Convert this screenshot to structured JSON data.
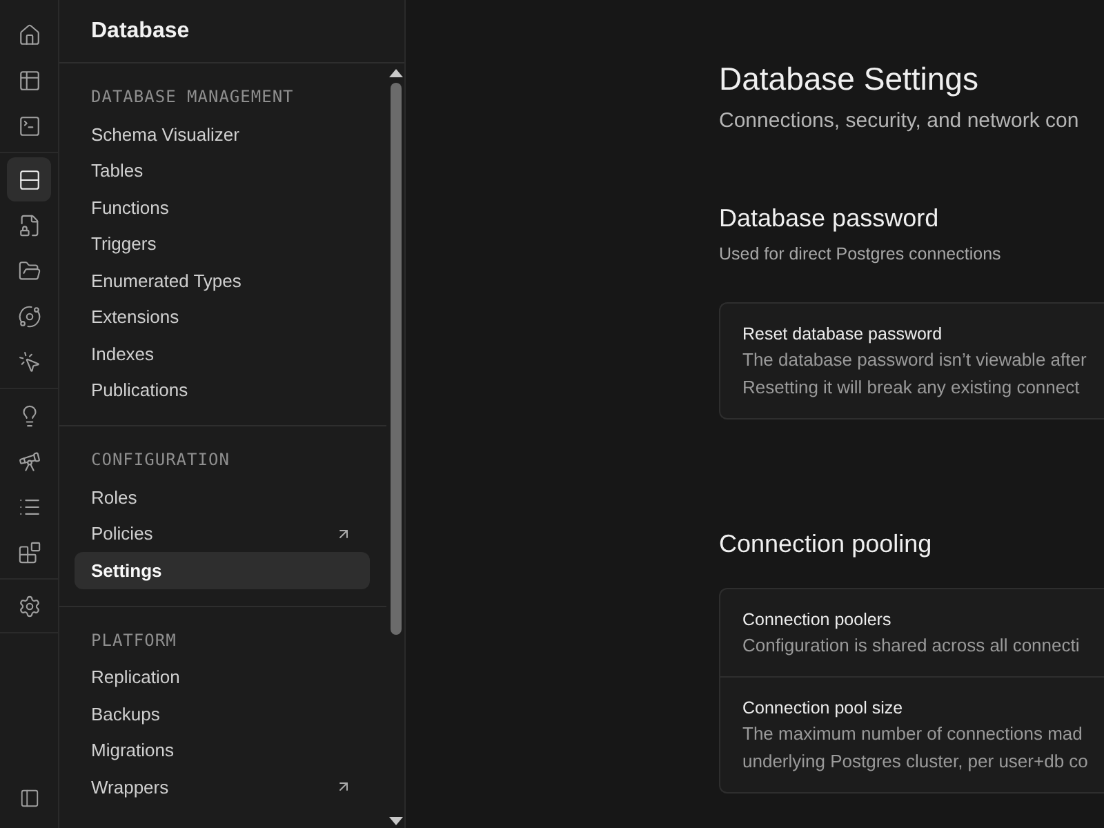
{
  "rail": {
    "groups": [
      [
        {
          "selected": false
        },
        {
          "selected": false
        },
        {
          "selected": false
        }
      ],
      [
        {
          "selected": true
        },
        {
          "selected": false
        },
        {
          "selected": false
        },
        {
          "selected": false
        },
        {
          "selected": false
        }
      ],
      [
        {
          "selected": false
        },
        {
          "selected": false
        },
        {
          "selected": false
        },
        {
          "selected": false
        }
      ],
      [
        {
          "selected": false
        }
      ]
    ]
  },
  "sidebar": {
    "title": "Database",
    "sections": [
      {
        "title": "DATABASE MANAGEMENT",
        "items": [
          {
            "label": "Schema Visualizer",
            "selected": false,
            "external": false
          },
          {
            "label": "Tables",
            "selected": false,
            "external": false
          },
          {
            "label": "Functions",
            "selected": false,
            "external": false
          },
          {
            "label": "Triggers",
            "selected": false,
            "external": false
          },
          {
            "label": "Enumerated Types",
            "selected": false,
            "external": false
          },
          {
            "label": "Extensions",
            "selected": false,
            "external": false
          },
          {
            "label": "Indexes",
            "selected": false,
            "external": false
          },
          {
            "label": "Publications",
            "selected": false,
            "external": false
          }
        ]
      },
      {
        "title": "CONFIGURATION",
        "items": [
          {
            "label": "Roles",
            "selected": false,
            "external": false
          },
          {
            "label": "Policies",
            "selected": false,
            "external": true
          },
          {
            "label": "Settings",
            "selected": true,
            "external": false
          }
        ]
      },
      {
        "title": "PLATFORM",
        "items": [
          {
            "label": "Replication",
            "selected": false,
            "external": false
          },
          {
            "label": "Backups",
            "selected": false,
            "external": false
          },
          {
            "label": "Migrations",
            "selected": false,
            "external": false
          },
          {
            "label": "Wrappers",
            "selected": false,
            "external": true
          }
        ]
      }
    ]
  },
  "page": {
    "title": "Database Settings",
    "subtitle": "Connections, security, and network con"
  },
  "sections": [
    {
      "title": "Database password",
      "description": "Used for direct Postgres connections",
      "rows": [
        {
          "title": "Reset database password",
          "lines": [
            "The database password isn’t viewable after",
            "Resetting it will break any existing connect"
          ]
        }
      ]
    },
    {
      "title": "Connection pooling",
      "rows": [
        {
          "title": "Connection poolers",
          "lines": [
            "Configuration is shared across all connecti"
          ]
        },
        {
          "title": "Connection pool size",
          "lines": [
            "The maximum number of connections mad",
            "underlying Postgres cluster, per user+db co"
          ]
        }
      ]
    }
  ]
}
